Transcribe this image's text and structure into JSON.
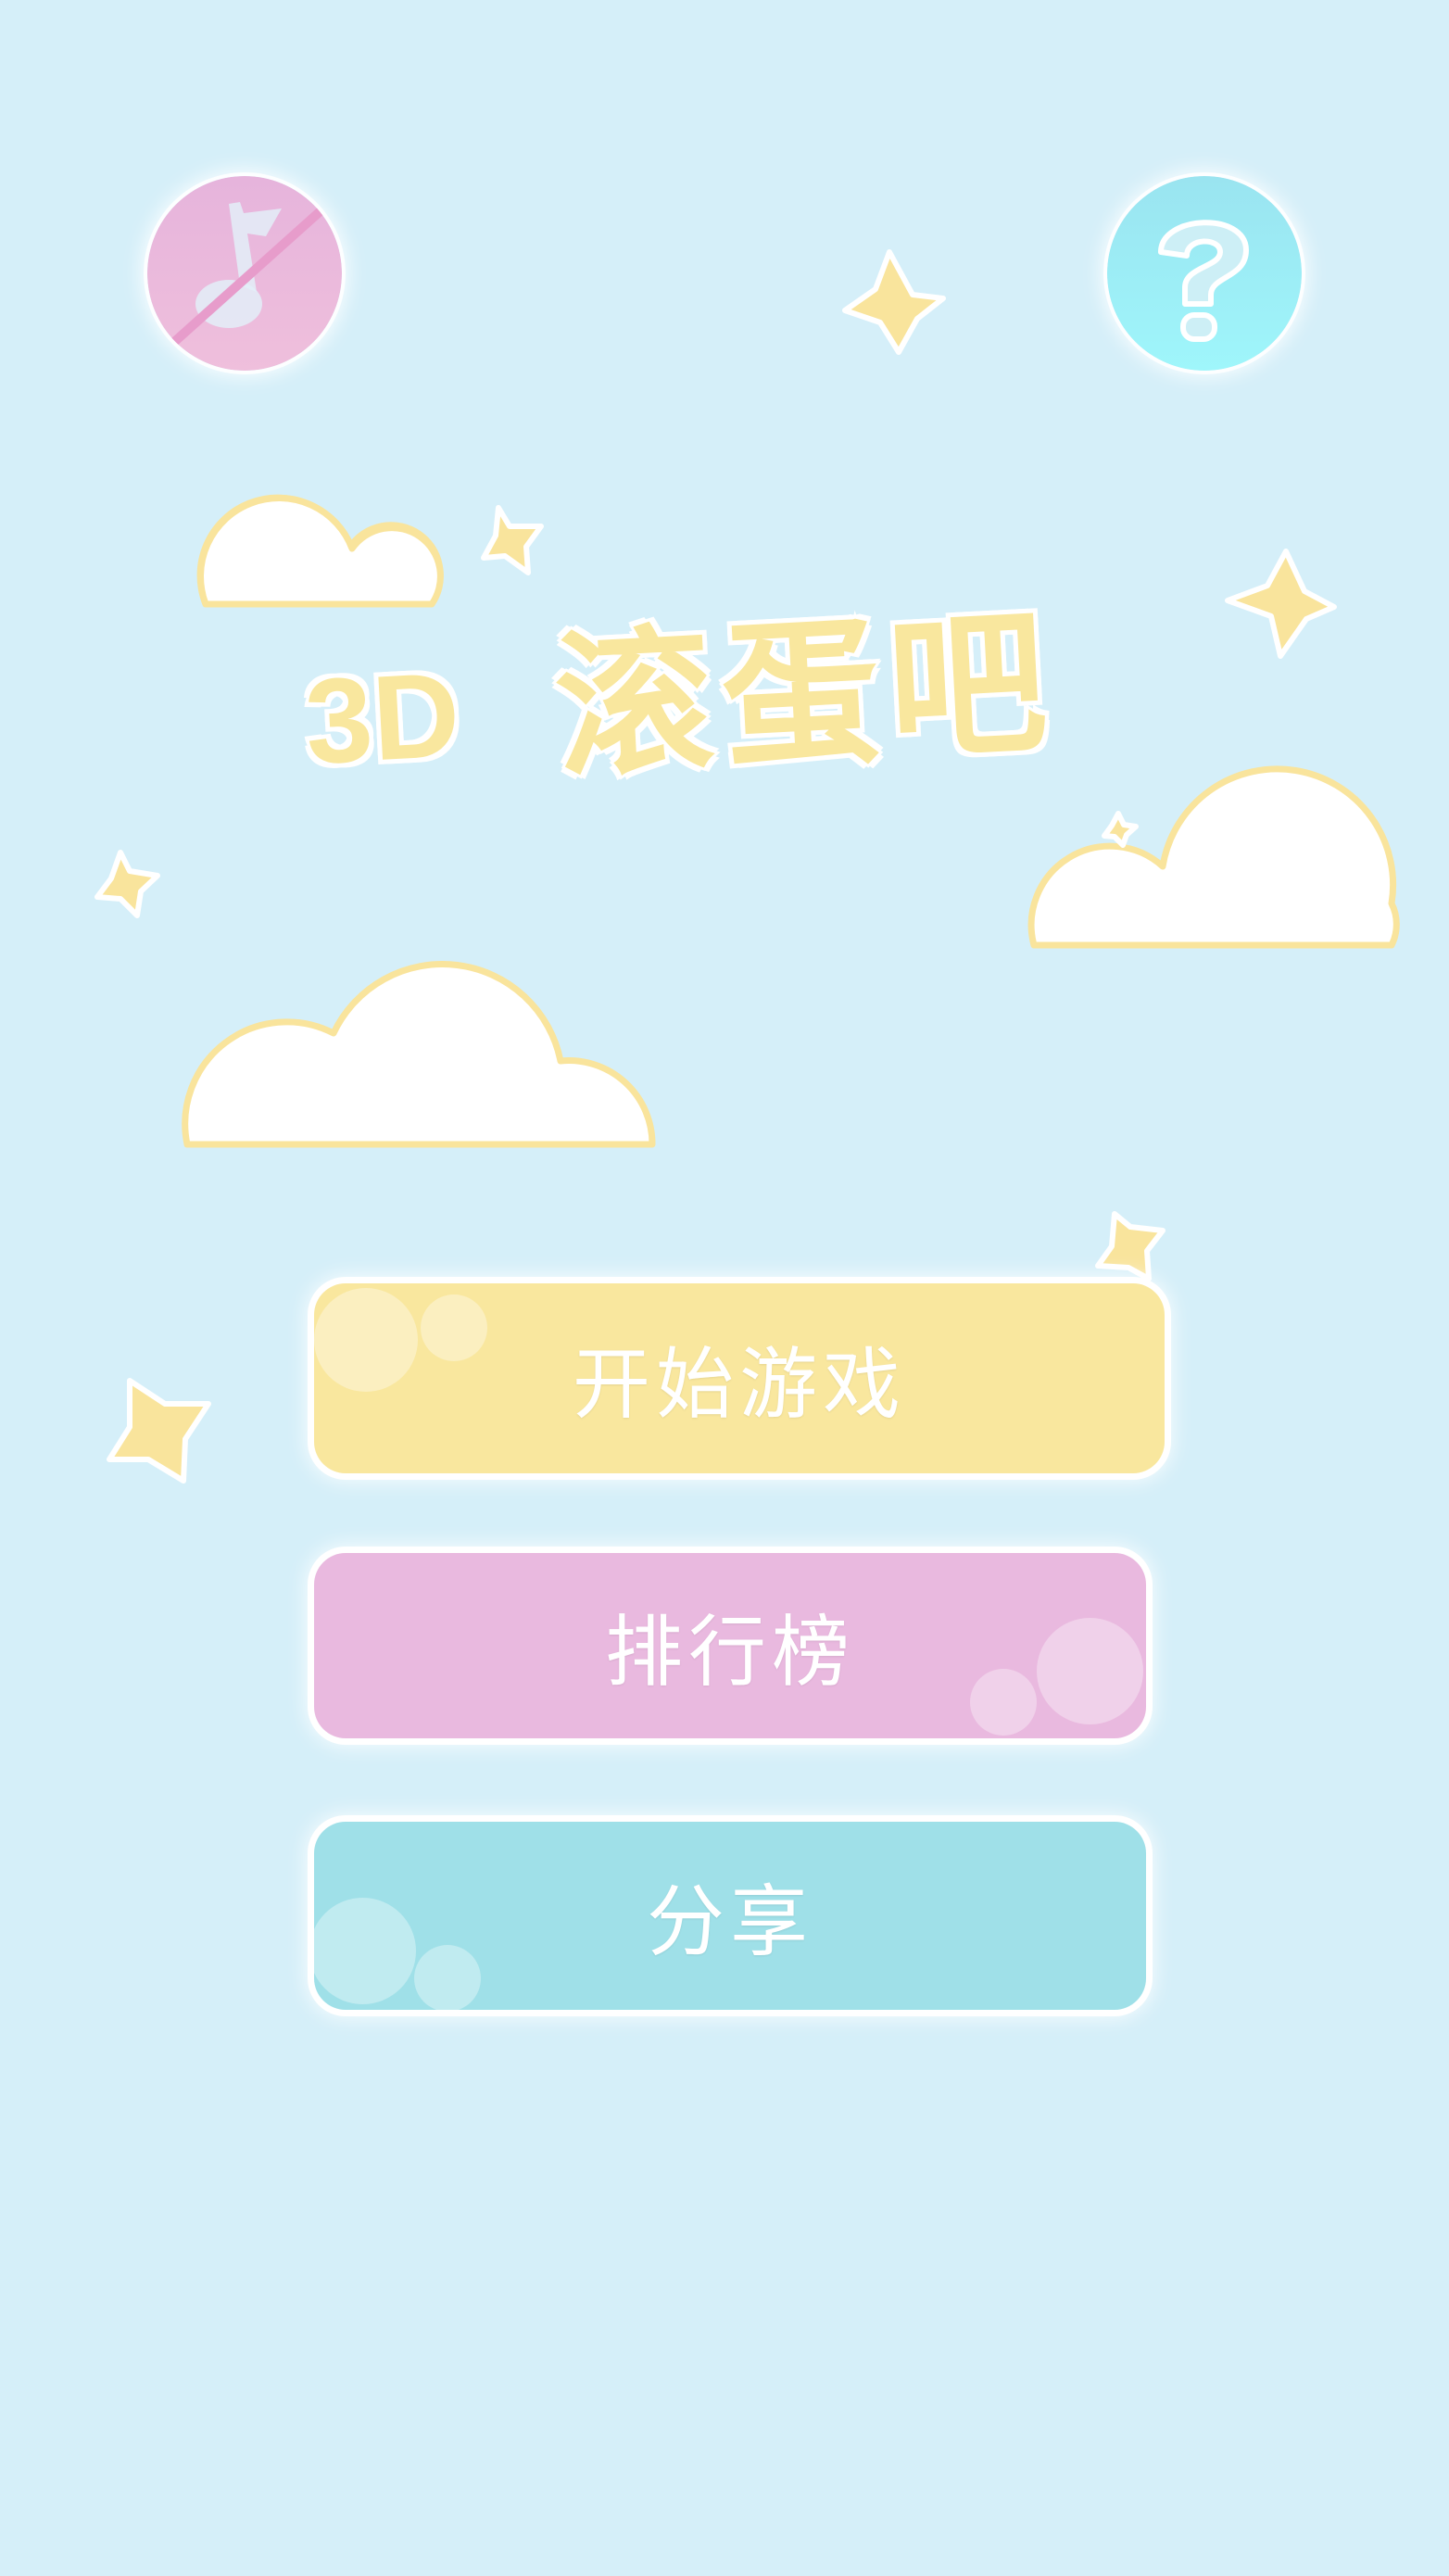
{
  "top_bar": {
    "music_toggle": {
      "icon": "music-off-icon",
      "state": "muted",
      "color": "#eab9d9"
    },
    "help_button": {
      "icon": "question-icon",
      "color": "#9af0f8"
    }
  },
  "title": {
    "prefix": "3D",
    "main": "滚蛋吧"
  },
  "menu": {
    "start_label": "开始游戏",
    "rank_label": "排行榜",
    "share_label": "分享"
  },
  "colors": {
    "background": "#d5eff9",
    "yellow": "#f9e79e",
    "pink": "#e9b9df",
    "cyan": "#9fe0e8",
    "cloud_outline": "#f9e49c"
  }
}
